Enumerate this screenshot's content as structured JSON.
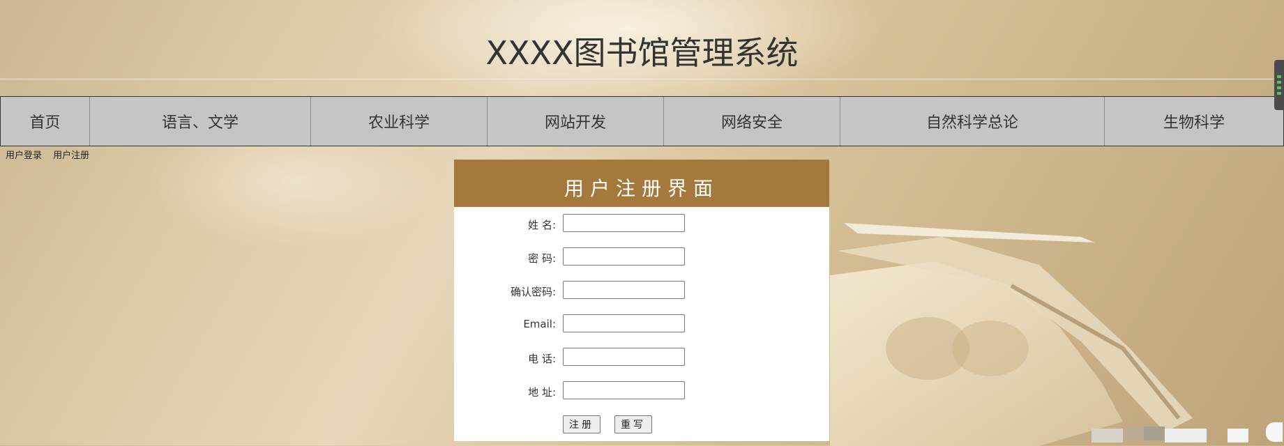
{
  "site": {
    "title": "XXXX图书馆管理系统"
  },
  "nav": {
    "items": [
      {
        "label": "首页"
      },
      {
        "label": "语言、文学"
      },
      {
        "label": "农业科学"
      },
      {
        "label": "网站开发"
      },
      {
        "label": "网络安全"
      },
      {
        "label": "自然科学总论"
      },
      {
        "label": "生物科学"
      }
    ]
  },
  "user_links": {
    "login": "用户登录",
    "register": "用户注册"
  },
  "register_form": {
    "title": "用户注册界面",
    "fields": [
      {
        "label": "姓  名:",
        "value": ""
      },
      {
        "label": "密  码:",
        "value": ""
      },
      {
        "label": "确认密码:",
        "value": ""
      },
      {
        "label": "Email:",
        "value": ""
      },
      {
        "label": "电  话:",
        "value": ""
      },
      {
        "label": "地  址:",
        "value": ""
      }
    ],
    "submit_label": "注册",
    "reset_label": "重写"
  },
  "colors": {
    "nav_bg": "#c5c5c5",
    "panel_head": "#a5793c",
    "title_text": "#333333"
  }
}
